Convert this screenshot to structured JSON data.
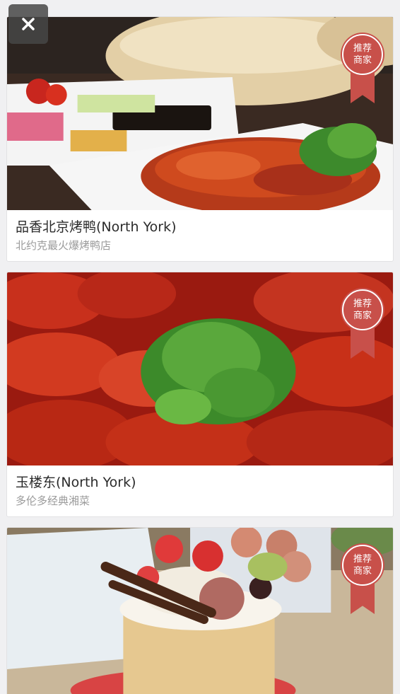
{
  "close": {
    "icon": "close-icon"
  },
  "badge": {
    "line1": "推荐",
    "line2": "商家",
    "color": "#c8504a"
  },
  "cards": [
    {
      "title": "品香北京烤鸭(North York)",
      "subtitle": "北约克最火爆烤鸭店",
      "image": "peking-duck-photo"
    },
    {
      "title": "玉楼东(North York)",
      "subtitle": "多伦多经典湘菜",
      "image": "crayfish-photo"
    },
    {
      "image": "dessert-toast-photo"
    }
  ]
}
